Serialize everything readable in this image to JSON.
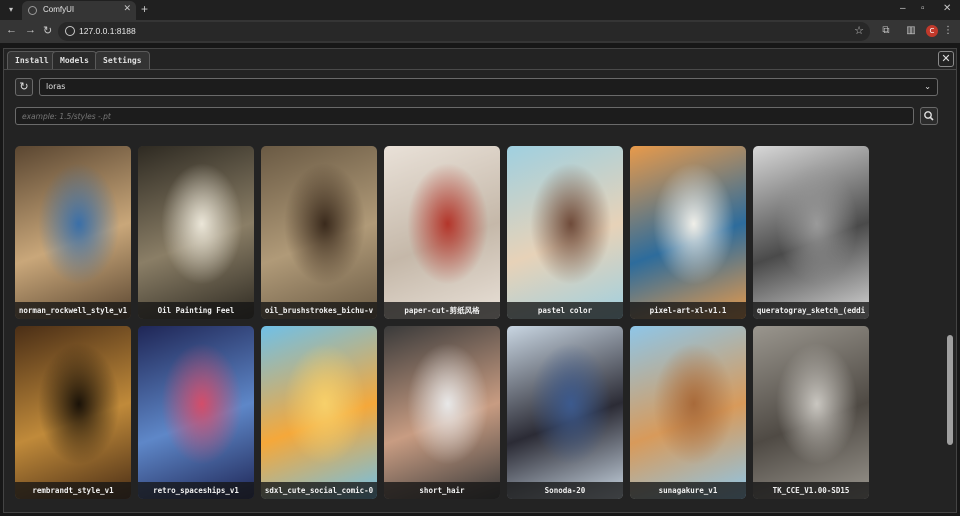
{
  "browser": {
    "tab_title": "ComfyUI",
    "url": "127.0.0.1:8188",
    "profile_initial": "C"
  },
  "manager": {
    "tabs": [
      "Install",
      "Models",
      "Settings"
    ],
    "active_tab": "Models",
    "category": "loras",
    "search_placeholder": "example: 1.5/styles -.pt"
  },
  "models": [
    {
      "name": "norman_rockwell_style_v1",
      "colors": [
        "#5a4631",
        "#c9a77a",
        "#3a6fa8"
      ]
    },
    {
      "name": "Oil Painting Feel",
      "colors": [
        "#2e2a22",
        "#8a7e66",
        "#ebe6d8"
      ]
    },
    {
      "name": "oil_brushstrokes_bichu-v",
      "colors": [
        "#6a5a44",
        "#b09a78",
        "#3a2a1c"
      ]
    },
    {
      "name": "paper-cut-剪纸风格",
      "colors": [
        "#e9e1d8",
        "#c5b8a9",
        "#b3352a"
      ]
    },
    {
      "name": "pastel color",
      "colors": [
        "#9fd0e0",
        "#e7d2b8",
        "#6f4b3a"
      ]
    },
    {
      "name": "pixel-art-xl-v1.1",
      "colors": [
        "#e89a4a",
        "#2d6c9c",
        "#f0efe9"
      ]
    },
    {
      "name": "queratogray_sketch_(eddi",
      "colors": [
        "#d8d8d8",
        "#4a4a4a",
        "#9a9a9a"
      ]
    },
    {
      "name": "rembrandt_style_v1",
      "colors": [
        "#4a2e16",
        "#c08a3a",
        "#1a1208"
      ]
    },
    {
      "name": "retro_spaceships_v1",
      "colors": [
        "#1f2656",
        "#5e87c8",
        "#d34d6a"
      ]
    },
    {
      "name": "sdxl_cute_social_comic-0",
      "colors": [
        "#6fc0e8",
        "#f5a83a",
        "#f7d06a"
      ]
    },
    {
      "name": "short_hair",
      "colors": [
        "#3a3a3a",
        "#c89c82",
        "#e8e8e8"
      ]
    },
    {
      "name": "Sonoda-20",
      "colors": [
        "#c9d6e2",
        "#2b2b35",
        "#3c5a8e"
      ]
    },
    {
      "name": "sunagakure_v1",
      "colors": [
        "#8ec6e8",
        "#d89a5a",
        "#a86a3a"
      ]
    },
    {
      "name": "TK_CCE_V1.00-SD15",
      "colors": [
        "#9a968e",
        "#4f4a44",
        "#c9c6c0"
      ]
    }
  ]
}
